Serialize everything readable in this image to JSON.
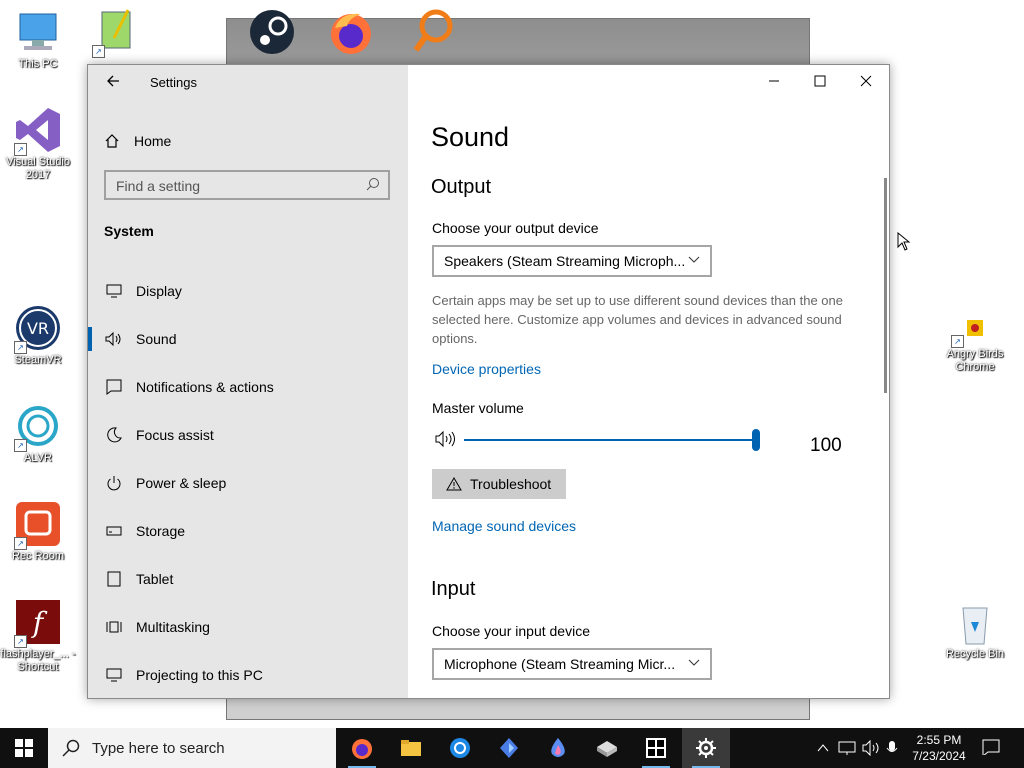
{
  "desktop": {
    "icons_left": [
      {
        "label": "This PC"
      },
      {
        "label": "Visual Studio 2017"
      },
      {
        "label": "SteamVR"
      },
      {
        "label": "ALVR"
      },
      {
        "label": "Rec Room"
      },
      {
        "label": "flashplayer_... - Shortcut"
      }
    ],
    "icons_right": [
      {
        "label": "Angry Birds Chrome"
      },
      {
        "label": "Recycle Bin"
      }
    ]
  },
  "settings": {
    "title": "Settings",
    "home_label": "Home",
    "search_placeholder": "Find a setting",
    "section_title": "System",
    "nav": [
      {
        "label": "Display",
        "icon": "monitor-icon"
      },
      {
        "label": "Sound",
        "icon": "speaker-icon",
        "active": true
      },
      {
        "label": "Notifications & actions",
        "icon": "notification-icon"
      },
      {
        "label": "Focus assist",
        "icon": "moon-icon"
      },
      {
        "label": "Power & sleep",
        "icon": "power-icon"
      },
      {
        "label": "Storage",
        "icon": "storage-icon"
      },
      {
        "label": "Tablet",
        "icon": "tablet-icon"
      },
      {
        "label": "Multitasking",
        "icon": "multitasking-icon"
      },
      {
        "label": "Projecting to this PC",
        "icon": "projector-icon"
      }
    ],
    "page": {
      "title": "Sound",
      "output_heading": "Output",
      "output_device_label": "Choose your output device",
      "output_device_value": "Speakers (Steam Streaming Microph...",
      "description": "Certain apps may be set up to use different sound devices than the one selected here. Customize app volumes and devices in advanced sound options.",
      "device_properties_link": "Device properties",
      "master_volume_label": "Master volume",
      "master_volume_value": "100",
      "troubleshoot_label": "Troubleshoot",
      "manage_devices_link": "Manage sound devices",
      "input_heading": "Input",
      "input_device_label": "Choose your input device",
      "input_device_value": "Microphone (Steam Streaming Micr..."
    }
  },
  "taskbar": {
    "search_placeholder": "Type here to search",
    "time": "2:55 PM",
    "date": "7/23/2024"
  },
  "colors": {
    "accent": "#0063b1",
    "link": "#0066b4",
    "sidebar": "#e6e6e6",
    "taskbar": "#101010"
  }
}
